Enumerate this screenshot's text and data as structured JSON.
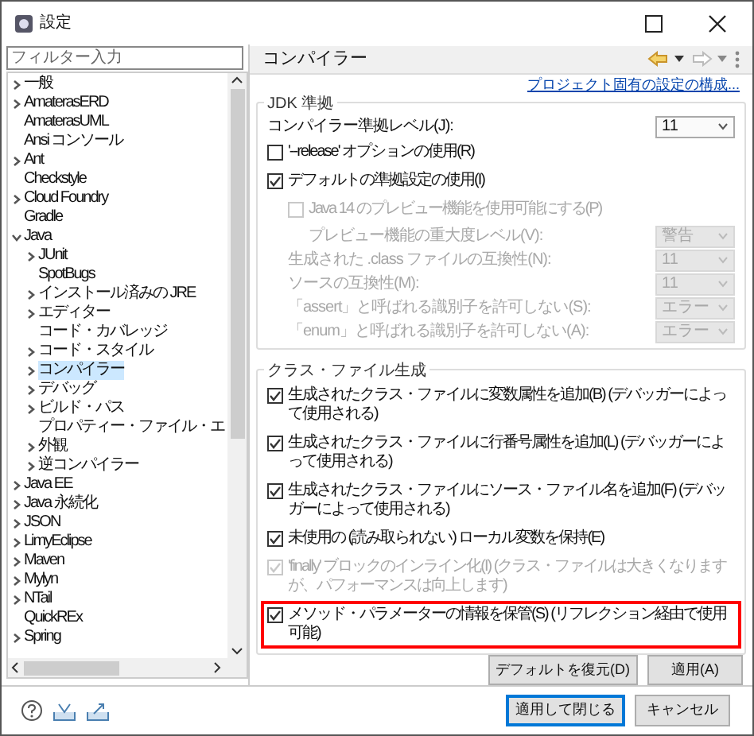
{
  "window": {
    "title": "設定"
  },
  "filter": {
    "placeholder": "フィルター入力"
  },
  "tree": [
    {
      "label": "一般",
      "expanded": false,
      "selected": false
    },
    {
      "label": "AmaterasERD",
      "expanded": false,
      "selected": false
    },
    {
      "label": "AmaterasUML",
      "selected": false
    },
    {
      "label": "Ansi コンソール",
      "selected": false
    },
    {
      "label": "Ant",
      "expanded": false,
      "selected": false
    },
    {
      "label": "Checkstyle",
      "selected": false
    },
    {
      "label": "Cloud Foundry",
      "expanded": false,
      "selected": false
    },
    {
      "label": "Gradle",
      "selected": false
    },
    {
      "label": "Java",
      "expanded": true,
      "selected": false,
      "children": [
        {
          "label": "JUnit",
          "expanded": false,
          "selected": false
        },
        {
          "label": "SpotBugs",
          "selected": false
        },
        {
          "label": "インストール済みの JRE",
          "expanded": false,
          "selected": false
        },
        {
          "label": "エディター",
          "expanded": false,
          "selected": false
        },
        {
          "label": "コード・カバレッジ",
          "selected": false
        },
        {
          "label": "コード・スタイル",
          "expanded": false,
          "selected": false
        },
        {
          "label": "コンパイラー",
          "expanded": false,
          "selected": true
        },
        {
          "label": "デバッグ",
          "expanded": false,
          "selected": false
        },
        {
          "label": "ビルド・パス",
          "expanded": false,
          "selected": false
        },
        {
          "label": "プロパティー・ファイル・エ",
          "selected": false
        },
        {
          "label": "外観",
          "expanded": false,
          "selected": false
        },
        {
          "label": "逆コンパイラー",
          "expanded": false,
          "selected": false
        }
      ]
    },
    {
      "label": "Java EE",
      "expanded": false,
      "selected": false
    },
    {
      "label": "Java 永続化",
      "expanded": false,
      "selected": false
    },
    {
      "label": "JSON",
      "expanded": false,
      "selected": false
    },
    {
      "label": "LimyEclipse",
      "expanded": false,
      "selected": false
    },
    {
      "label": "Maven",
      "expanded": false,
      "selected": false
    },
    {
      "label": "Mylyn",
      "expanded": false,
      "selected": false
    },
    {
      "label": "NTail",
      "expanded": false,
      "selected": false
    },
    {
      "label": "QuickREx",
      "selected": false
    },
    {
      "label": "Spring",
      "expanded": false,
      "selected": false
    }
  ],
  "page": {
    "title": "コンパイラー",
    "link": "プロジェクト固有の設定の構成...",
    "groups": [
      {
        "title": "JDK 準拠",
        "rows": [
          {
            "kind": "select",
            "label": "コンパイラー準拠レベル(J):",
            "value": "11",
            "disabled": false
          },
          {
            "kind": "checkbox",
            "label": "'--release' オプションの使用(R)",
            "checked": false,
            "disabled": false
          },
          {
            "kind": "checkbox",
            "label": "デフォルトの準拠設定の使用(I)",
            "checked": true,
            "disabled": false,
            "children": [
              {
                "kind": "checkbox",
                "label": "Java 14 のプレビュー機能を使用可能にする(P)",
                "checked": false,
                "disabled": true,
                "children": [
                  {
                    "kind": "select",
                    "label": "プレビュー機能の重大度レベル(V):",
                    "value": "警告",
                    "disabled": true
                  }
                ]
              },
              {
                "kind": "select",
                "label": "生成された .class ファイルの互換性(N):",
                "value": "11",
                "disabled": true
              },
              {
                "kind": "select",
                "label": "ソースの互換性(M):",
                "value": "11",
                "disabled": true
              },
              {
                "kind": "select",
                "label": "「assert」と呼ばれる識別子を許可しない(S):",
                "value": "エラー",
                "disabled": true
              },
              {
                "kind": "select",
                "label": "「enum」と呼ばれる識別子を許可しない(A):",
                "value": "エラー",
                "disabled": true
              }
            ]
          }
        ]
      },
      {
        "title": "クラス・ファイル生成",
        "rows": [
          {
            "kind": "checkbox",
            "label": "生成されたクラス・ファイルに変数属性を追加(B) (デバッガーによって使用される)",
            "checked": true,
            "disabled": false,
            "highlighted": false
          },
          {
            "kind": "checkbox",
            "label": "生成されたクラス・ファイルに行番号属性を追加(L) (デバッガーによって使用される)",
            "checked": true,
            "disabled": false,
            "highlighted": false
          },
          {
            "kind": "checkbox",
            "label": "生成されたクラス・ファイルにソース・ファイル名を追加(F) (デバッガーによって使用される)",
            "checked": true,
            "disabled": false,
            "highlighted": false
          },
          {
            "kind": "checkbox",
            "label": "未使用の (読み取られない) ローカル変数を保持(E)",
            "checked": true,
            "disabled": false,
            "highlighted": false
          },
          {
            "kind": "checkbox",
            "label": "'finally' ブロックのインライン化(I) (クラス・ファイルは大きくなりますが、パフォーマンスは向上します)",
            "checked": true,
            "disabled": true,
            "highlighted": false
          },
          {
            "kind": "checkbox",
            "label": "メソッド・パラメーターの情報を保管(S) (リフレクション経由で使用可能)",
            "checked": true,
            "disabled": false,
            "highlighted": true
          }
        ]
      }
    ],
    "buttons": [
      "デフォルトを復元(D)",
      "適用(A)"
    ]
  },
  "footer": {
    "buttons": [
      {
        "label": "適用して閉じる",
        "default": true
      },
      {
        "label": "キャンセル",
        "default": false
      }
    ]
  }
}
